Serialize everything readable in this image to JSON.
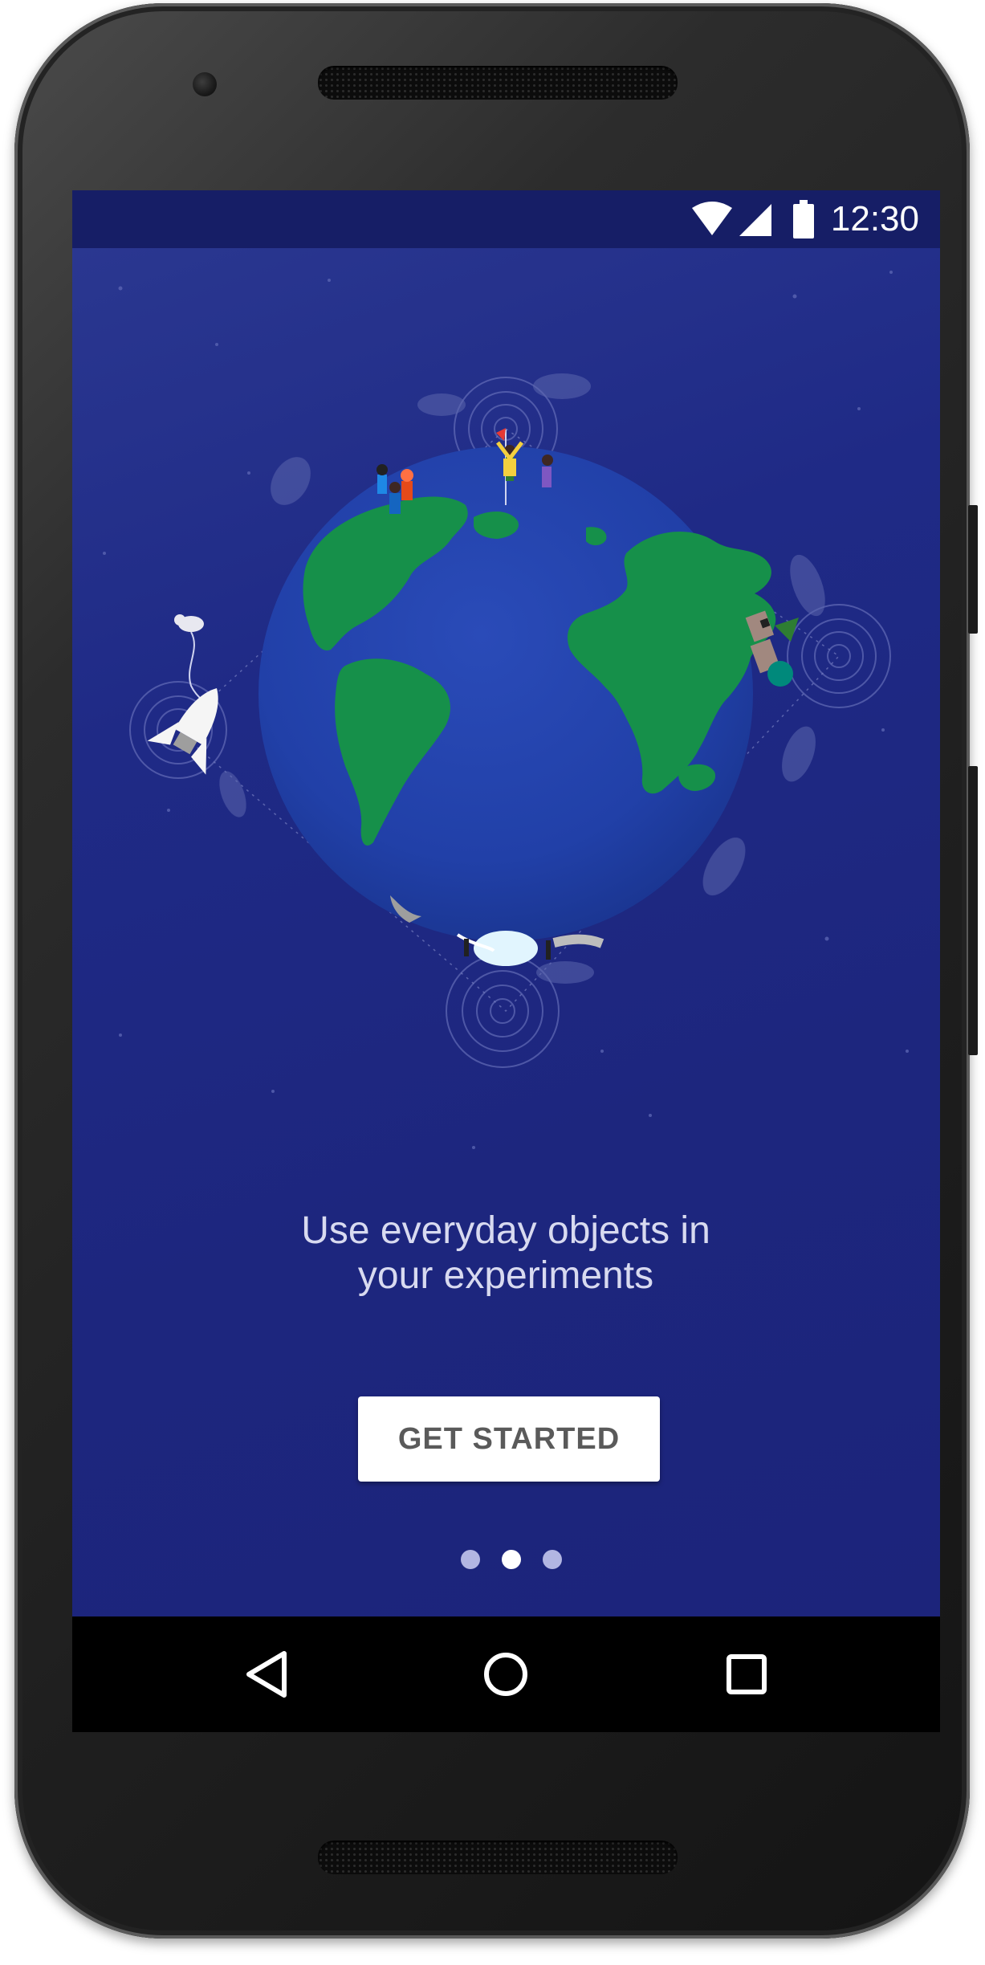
{
  "status_bar": {
    "time": "12:30",
    "icons": [
      "wifi-icon",
      "cell-signal-icon",
      "battery-icon"
    ]
  },
  "onboarding": {
    "tagline_line1": "Use everyday objects in",
    "tagline_line2": "your experiments",
    "button_label": "GET STARTED",
    "pages": 3,
    "active_page": 2
  },
  "nav_bar": {
    "icons": [
      "back-icon",
      "home-icon",
      "recents-icon"
    ]
  },
  "colors": {
    "background": "#1c247c",
    "status_bar": "#161e66",
    "globe_ocean": "#2140a8",
    "globe_land": "#16904a",
    "button": "#ffffff",
    "button_text": "#5a5a5a",
    "dot_inactive": "#b2b6e2",
    "dot_active": "#ffffff"
  }
}
